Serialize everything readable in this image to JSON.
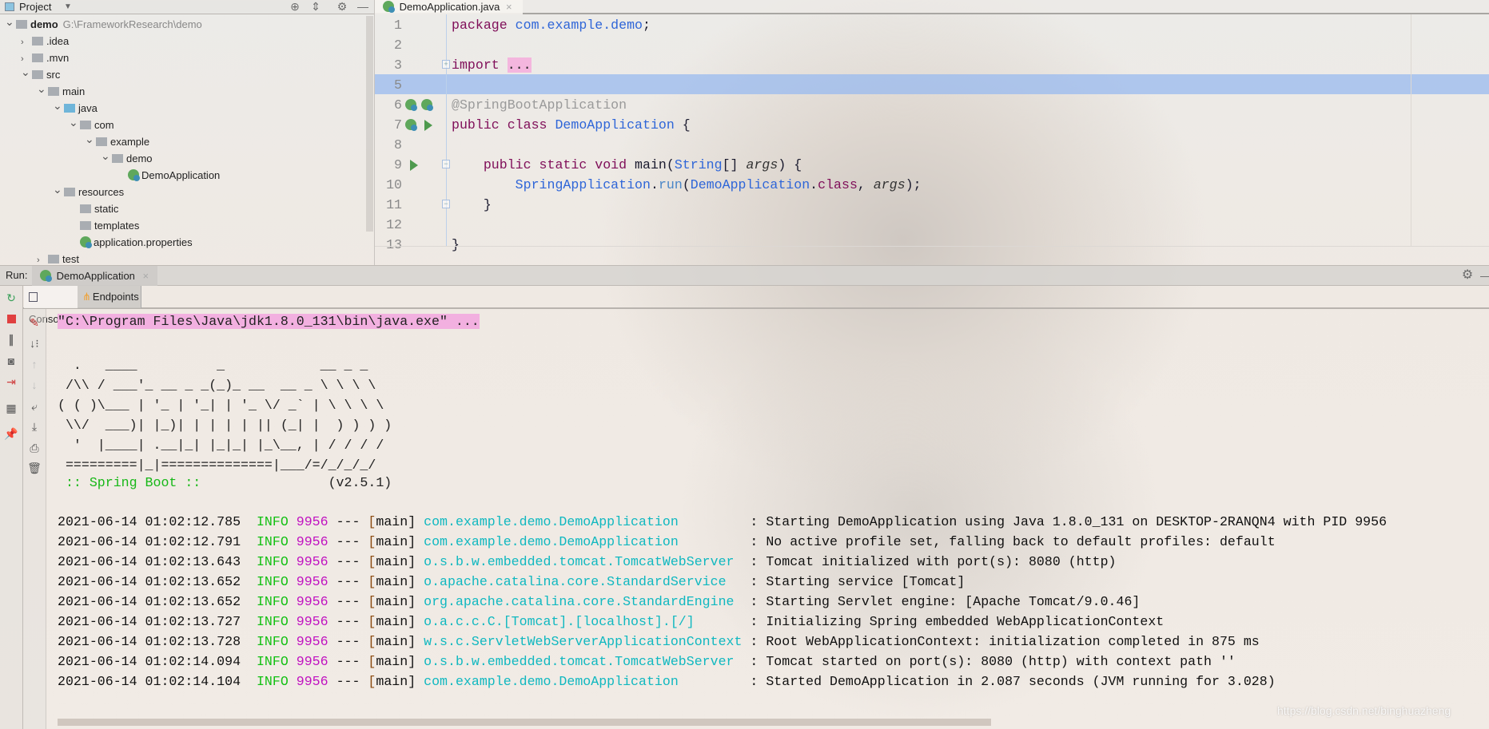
{
  "project_panel": {
    "title": "Project",
    "tree": [
      {
        "label": "demo",
        "path": "G:\\FrameworkResearch\\demo",
        "level": 0,
        "arrow": "expanded",
        "icon": "module-folder"
      },
      {
        "label": ".idea",
        "level": 1,
        "arrow": "collapsed",
        "icon": "folder"
      },
      {
        "label": ".mvn",
        "level": 1,
        "arrow": "collapsed",
        "icon": "folder"
      },
      {
        "label": "src",
        "level": 1,
        "arrow": "expanded",
        "icon": "folder"
      },
      {
        "label": "main",
        "level": 2,
        "arrow": "expanded",
        "icon": "folder"
      },
      {
        "label": "java",
        "level": 3,
        "arrow": "expanded",
        "icon": "source-folder"
      },
      {
        "label": "com",
        "level": 4,
        "arrow": "expanded",
        "icon": "package"
      },
      {
        "label": "example",
        "level": 5,
        "arrow": "expanded",
        "icon": "package"
      },
      {
        "label": "demo",
        "level": 6,
        "arrow": "expanded",
        "icon": "package"
      },
      {
        "label": "DemoApplication",
        "level": 7,
        "arrow": "none",
        "icon": "spring-class"
      },
      {
        "label": "resources",
        "level": 3,
        "arrow": "expanded",
        "icon": "resources-folder"
      },
      {
        "label": "static",
        "level": 4,
        "arrow": "none",
        "icon": "folder"
      },
      {
        "label": "templates",
        "level": 4,
        "arrow": "none",
        "icon": "folder"
      },
      {
        "label": "application.properties",
        "level": 4,
        "arrow": "none",
        "icon": "spring-properties"
      },
      {
        "label": "test",
        "level": 2,
        "arrow": "collapsed",
        "icon": "folder"
      }
    ]
  },
  "editor": {
    "tab": "DemoApplication.java",
    "lines": [
      {
        "n": "1",
        "tokens": [
          [
            "kw",
            "package "
          ],
          [
            "pkg",
            "com.example.demo"
          ],
          [
            "plain",
            ";"
          ]
        ]
      },
      {
        "n": "2",
        "tokens": []
      },
      {
        "n": "3",
        "tokens": [
          [
            "kw",
            "import "
          ],
          [
            "fold",
            "..."
          ]
        ],
        "fold": true
      },
      {
        "n": "5",
        "tokens": [],
        "current": true
      },
      {
        "n": "6",
        "tokens": [
          [
            "ann",
            "@SpringBootApplication"
          ]
        ],
        "gutter": [
          "spring-bean-icon",
          "spring-boot-icon"
        ]
      },
      {
        "n": "7",
        "tokens": [
          [
            "kw",
            "public class "
          ],
          [
            "cls",
            "DemoApplication"
          ],
          [
            "plain",
            " {"
          ]
        ],
        "gutter": [
          "spring-class-icon",
          "run-icon"
        ]
      },
      {
        "n": "8",
        "tokens": []
      },
      {
        "n": "9",
        "tokens": [
          [
            "plain",
            "    "
          ],
          [
            "kw",
            "public static void "
          ],
          [
            "plain",
            "main("
          ],
          [
            "cls",
            "String"
          ],
          [
            "plain",
            "[] "
          ],
          [
            "it",
            "args"
          ],
          [
            "plain",
            ") {"
          ]
        ],
        "gutter": [
          "run-icon"
        ],
        "fold": true
      },
      {
        "n": "10",
        "tokens": [
          [
            "plain",
            "        "
          ],
          [
            "cls",
            "SpringApplication"
          ],
          [
            "plain",
            "."
          ],
          [
            "meth",
            "run"
          ],
          [
            "plain",
            "("
          ],
          [
            "cls",
            "DemoApplication"
          ],
          [
            "plain",
            "."
          ],
          [
            "kw",
            "class"
          ],
          [
            "plain",
            ", "
          ],
          [
            "it",
            "args"
          ],
          [
            "plain",
            ");"
          ]
        ]
      },
      {
        "n": "11",
        "tokens": [
          [
            "plain",
            "    }"
          ]
        ],
        "fold": true
      },
      {
        "n": "12",
        "tokens": []
      },
      {
        "n": "13",
        "tokens": [
          [
            "plain",
            "}"
          ]
        ]
      }
    ]
  },
  "run_panel": {
    "label": "Run:",
    "tab": "DemoApplication",
    "subtabs": [
      "Console",
      "Endpoints"
    ],
    "command": "\"C:\\Program Files\\Java\\jdk1.8.0_131\\bin\\java.exe\" ...",
    "banner": [
      "  .   ____          _            __ _ _",
      " /\\\\ / ___'_ __ _ _(_)_ __  __ _ \\ \\ \\ \\",
      "( ( )\\___ | '_ | '_| | '_ \\/ _` | \\ \\ \\ \\",
      " \\\\/  ___)| |_)| | | | | || (_| |  ) ) ) )",
      "  '  |____| .__|_| |_|_| |_\\__, | / / / /",
      " =========|_|==============|___/=/_/_/_/"
    ],
    "spring_boot_label": " :: Spring Boot :: ",
    "spring_boot_version": "               (v2.5.1)",
    "logs": [
      {
        "ts": "2021-06-14 01:02:12.785",
        "level": "INFO",
        "pid": "9956",
        "thread": "main",
        "logger": "com.example.demo.DemoApplication",
        "msg": "Starting DemoApplication using Java 1.8.0_131 on DESKTOP-2RANQN4 with PID 9956"
      },
      {
        "ts": "2021-06-14 01:02:12.791",
        "level": "INFO",
        "pid": "9956",
        "thread": "main",
        "logger": "com.example.demo.DemoApplication",
        "msg": "No active profile set, falling back to default profiles: default"
      },
      {
        "ts": "2021-06-14 01:02:13.643",
        "level": "INFO",
        "pid": "9956",
        "thread": "main",
        "logger": "o.s.b.w.embedded.tomcat.TomcatWebServer",
        "msg": "Tomcat initialized with port(s): 8080 (http)"
      },
      {
        "ts": "2021-06-14 01:02:13.652",
        "level": "INFO",
        "pid": "9956",
        "thread": "main",
        "logger": "o.apache.catalina.core.StandardService",
        "msg": "Starting service [Tomcat]"
      },
      {
        "ts": "2021-06-14 01:02:13.652",
        "level": "INFO",
        "pid": "9956",
        "thread": "main",
        "logger": "org.apache.catalina.core.StandardEngine",
        "msg": "Starting Servlet engine: [Apache Tomcat/9.0.46]"
      },
      {
        "ts": "2021-06-14 01:02:13.727",
        "level": "INFO",
        "pid": "9956",
        "thread": "main",
        "logger": "o.a.c.c.C.[Tomcat].[localhost].[/]",
        "msg": "Initializing Spring embedded WebApplicationContext"
      },
      {
        "ts": "2021-06-14 01:02:13.728",
        "level": "INFO",
        "pid": "9956",
        "thread": "main",
        "logger": "w.s.c.ServletWebServerApplicationContext",
        "msg": "Root WebApplicationContext: initialization completed in 875 ms"
      },
      {
        "ts": "2021-06-14 01:02:14.094",
        "level": "INFO",
        "pid": "9956",
        "thread": "main",
        "logger": "o.s.b.w.embedded.tomcat.TomcatWebServer",
        "msg": "Tomcat started on port(s): 8080 (http) with context path ''"
      },
      {
        "ts": "2021-06-14 01:02:14.104",
        "level": "INFO",
        "pid": "9956",
        "thread": "main",
        "logger": "com.example.demo.DemoApplication",
        "msg": "Started DemoApplication in 2.087 seconds (JVM running for 3.028)"
      }
    ]
  },
  "watermark": "https://blog.csdn.net/binghuazheng",
  "colors": {
    "keyword": "#80105a",
    "info": "#13c013",
    "pid": "#c010c0",
    "logger": "#10b8c0",
    "current_line": "#a9c6f0",
    "highlight": "#f4b6de"
  }
}
